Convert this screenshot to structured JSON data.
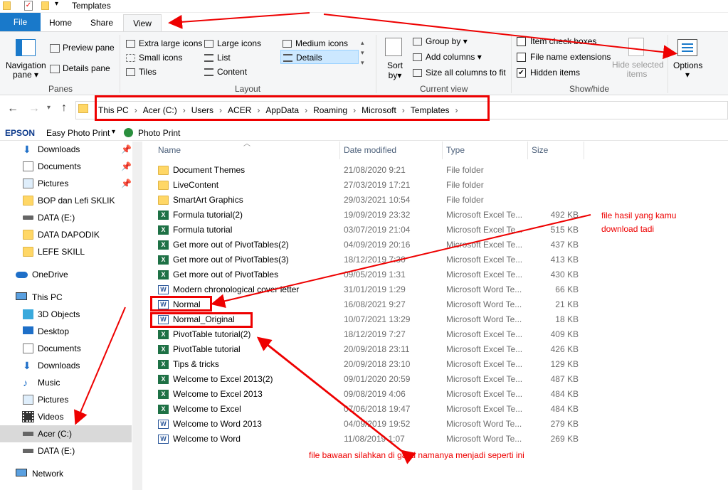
{
  "window": {
    "title": "Templates"
  },
  "tabs": [
    "File",
    "Home",
    "Share",
    "View"
  ],
  "ribbon": {
    "panes": {
      "nav": "Navigation",
      "nav2": "pane",
      "preview": "Preview pane",
      "details": "Details pane",
      "label": "Panes"
    },
    "layout": {
      "items": [
        "Extra large icons",
        "Large icons",
        "Medium icons",
        "Small icons",
        "List",
        "Details",
        "Tiles",
        "Content"
      ],
      "label": "Layout"
    },
    "view": {
      "sort": "Sort",
      "sort2": "by",
      "group": "Group by",
      "add": "Add columns",
      "size": "Size all columns to fit",
      "label": "Current view"
    },
    "showhide": {
      "check": "Item check boxes",
      "ext": "File name extensions",
      "hidden": "Hidden items",
      "hide1": "Hide selected",
      "hide2": "items",
      "label": "Show/hide"
    },
    "options": "Options"
  },
  "breadcrumb": [
    "This PC",
    "Acer (C:)",
    "Users",
    "ACER",
    "AppData",
    "Roaming",
    "Microsoft",
    "Templates"
  ],
  "favorites": {
    "brand": "EPSON",
    "easy": "Easy Photo Print",
    "photo": "Photo Print"
  },
  "sidebar": [
    "Downloads",
    "Documents",
    "Pictures",
    "BOP dan Lefi SKLIK",
    "DATA (E:)",
    "DATA DAPODIK",
    "LEFE SKILL",
    "OneDrive",
    "This PC",
    "3D Objects",
    "Desktop",
    "Documents",
    "Downloads",
    "Music",
    "Pictures",
    "Videos",
    "Acer (C:)",
    "DATA (E:)",
    "Network"
  ],
  "columns": {
    "name": "Name",
    "date": "Date modified",
    "type": "Type",
    "size": "Size"
  },
  "files": [
    {
      "name": "Document Themes",
      "date": "21/08/2020 9:21",
      "type": "File folder",
      "size": "",
      "kind": "folder"
    },
    {
      "name": "LiveContent",
      "date": "27/03/2019 17:21",
      "type": "File folder",
      "size": "",
      "kind": "folder"
    },
    {
      "name": "SmartArt Graphics",
      "date": "29/03/2021 10:54",
      "type": "File folder",
      "size": "",
      "kind": "folder"
    },
    {
      "name": "Formula tutorial(2)",
      "date": "19/09/2019 23:32",
      "type": "Microsoft Excel Te...",
      "size": "492 KB",
      "kind": "excel"
    },
    {
      "name": "Formula tutorial",
      "date": "03/07/2019 21:04",
      "type": "Microsoft Excel Te...",
      "size": "515 KB",
      "kind": "excel"
    },
    {
      "name": "Get more out of PivotTables(2)",
      "date": "04/09/2019 20:16",
      "type": "Microsoft Excel Te...",
      "size": "437 KB",
      "kind": "excel"
    },
    {
      "name": "Get more out of PivotTables(3)",
      "date": "18/12/2019 7:30",
      "type": "Microsoft Excel Te...",
      "size": "413 KB",
      "kind": "excel"
    },
    {
      "name": "Get more out of PivotTables",
      "date": "09/05/2019 1:31",
      "type": "Microsoft Excel Te...",
      "size": "430 KB",
      "kind": "excel"
    },
    {
      "name": "Modern chronological cover letter",
      "date": "31/01/2019 1:29",
      "type": "Microsoft Word Te...",
      "size": "66 KB",
      "kind": "word"
    },
    {
      "name": "Normal",
      "date": "16/08/2021 9:27",
      "type": "Microsoft Word Te...",
      "size": "21 KB",
      "kind": "word"
    },
    {
      "name": "Normal_Original",
      "date": "10/07/2021 13:29",
      "type": "Microsoft Word Te...",
      "size": "18 KB",
      "kind": "word"
    },
    {
      "name": "PivotTable tutorial(2)",
      "date": "18/12/2019 7:27",
      "type": "Microsoft Excel Te...",
      "size": "409 KB",
      "kind": "excel"
    },
    {
      "name": "PivotTable tutorial",
      "date": "20/09/2018 23:11",
      "type": "Microsoft Excel Te...",
      "size": "426 KB",
      "kind": "excel"
    },
    {
      "name": "Tips & tricks",
      "date": "20/09/2018 23:10",
      "type": "Microsoft Excel Te...",
      "size": "129 KB",
      "kind": "excel"
    },
    {
      "name": "Welcome to Excel 2013(2)",
      "date": "09/01/2020 20:59",
      "type": "Microsoft Excel Te...",
      "size": "487 KB",
      "kind": "excel"
    },
    {
      "name": "Welcome to Excel 2013",
      "date": "09/08/2019 4:06",
      "type": "Microsoft Excel Te...",
      "size": "484 KB",
      "kind": "excel"
    },
    {
      "name": "Welcome to Excel",
      "date": "07/06/2018 19:47",
      "type": "Microsoft Excel Te...",
      "size": "484 KB",
      "kind": "excel"
    },
    {
      "name": "Welcome to Word 2013",
      "date": "04/09/2019 19:52",
      "type": "Microsoft Word Te...",
      "size": "279 KB",
      "kind": "word"
    },
    {
      "name": "Welcome to Word",
      "date": "11/08/2019 1:07",
      "type": "Microsoft Word Te...",
      "size": "269 KB",
      "kind": "word"
    }
  ],
  "annotations": {
    "downloaded1": "file hasil yang kamu",
    "downloaded2": "download tadi",
    "rename": "file bawaan silahkan di ganti namanya menjadi seperti ini"
  }
}
